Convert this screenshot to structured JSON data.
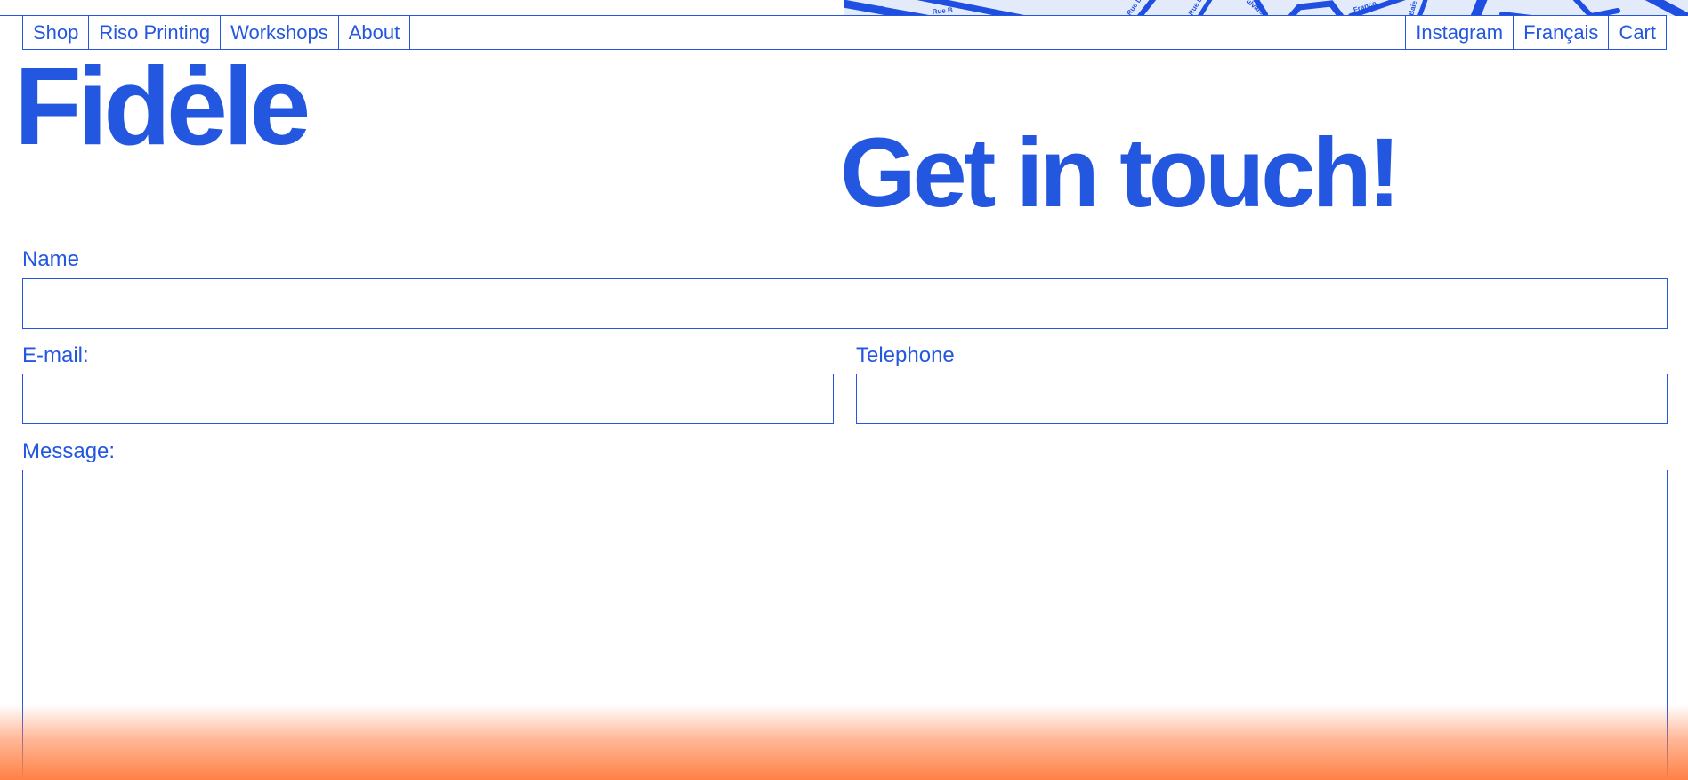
{
  "nav": {
    "left": [
      {
        "label": "Shop"
      },
      {
        "label": "Riso Printing"
      },
      {
        "label": "Workshops"
      },
      {
        "label": "About"
      }
    ],
    "right": [
      {
        "label": "Instagram"
      },
      {
        "label": "Français"
      },
      {
        "label": "Cart"
      }
    ]
  },
  "brand": {
    "logo": "Fidėle"
  },
  "page": {
    "heading": "Get in touch!"
  },
  "map": {
    "street_labels": [
      "Rue Ré",
      "Rue B",
      "Rue D",
      "Rue Du",
      "ulvars",
      "Franço",
      "Baie"
    ]
  },
  "form": {
    "name_label": "Name",
    "name_value": "",
    "email_label": "E-mail:",
    "email_value": "",
    "telephone_label": "Telephone",
    "telephone_value": "",
    "message_label": "Message:",
    "message_value": ""
  },
  "colors": {
    "accent": "#2457e0",
    "map_background": "#e3ebfb",
    "footer_gradient": "#ff8045"
  }
}
